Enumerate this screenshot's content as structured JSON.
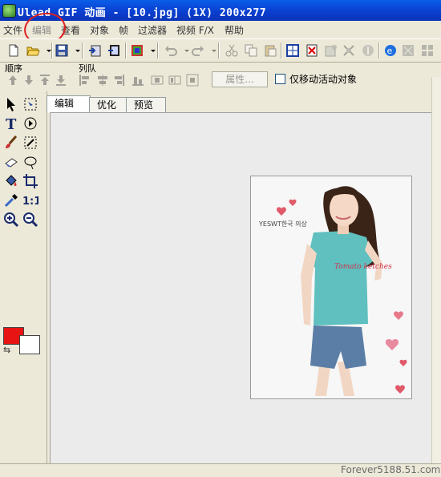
{
  "window": {
    "title": "Ulead GIF 动画 - [10.jpg] (1X) 200x277"
  },
  "menu": {
    "items": [
      "文件",
      "编辑",
      "查看",
      "对象",
      "帧",
      "过滤器",
      "视频 F/X",
      "帮助"
    ]
  },
  "toolbar2": {
    "order_label": "顺序",
    "queue_label": "列队",
    "properties_label": "属性...",
    "move_active_label": "仅移动活动对象",
    "move_active_checked": false
  },
  "tabs": [
    {
      "label": "编辑",
      "active": true
    },
    {
      "label": "优化",
      "active": false
    },
    {
      "label": "预览",
      "active": false
    }
  ],
  "toolbox": {
    "fg_color": "#e81414",
    "bg_color": "#ffffff",
    "actual_size_label": "1:1"
  },
  "photo": {
    "brand_text": "YESWT한국 의상",
    "shirt_text": "Tomato ketches"
  },
  "watermark": "Forever5188.51.com",
  "colors": {
    "titlebar": "#0a3fd0",
    "face": "#ece9d8",
    "annotation": "#e02020"
  }
}
